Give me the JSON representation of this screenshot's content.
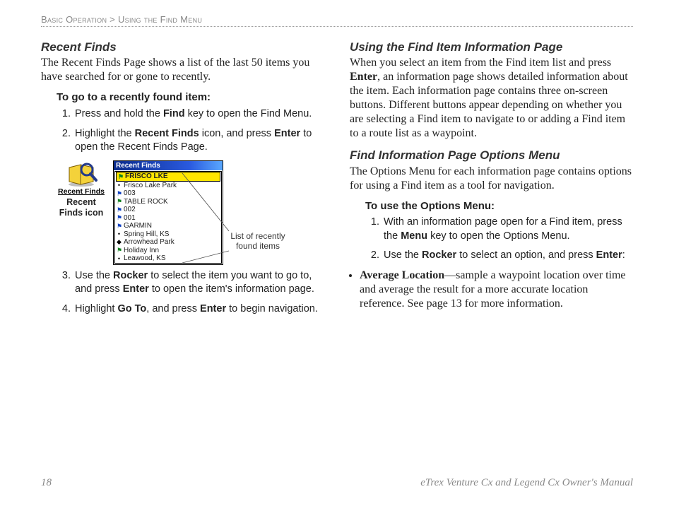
{
  "running_head": {
    "left": "Basic Operation",
    "sep": " > ",
    "right": "Using the Find Menu"
  },
  "left_col": {
    "h_recent": "Recent Finds",
    "p_recent": "The Recent Finds Page shows a list of the last 50 items you have searched for or gone to recently.",
    "instr_head": "To go to a recently found item:",
    "steps": {
      "s1a": "Press and hold the ",
      "s1b": "Find",
      "s1c": " key to open the Find Menu.",
      "s2a": "Highlight the ",
      "s2b": "Recent Finds",
      "s2c": " icon, and press ",
      "s2d": "Enter",
      "s2e": " to open the Recent Finds Page.",
      "s3a": "Use the ",
      "s3b": "Rocker",
      "s3c": " to select the item you want to go to, and press ",
      "s3d": "Enter",
      "s3e": " to open the item's information page.",
      "s4a": "Highlight ",
      "s4b": "Go To",
      "s4c": ", and press ",
      "s4d": "Enter",
      "s4e": " to begin navigation."
    },
    "icon_caption": "Recent Finds icon",
    "icon_label": "Recent Finds",
    "callout": "List of recently found items",
    "device": {
      "title": "Recent Finds",
      "items": [
        {
          "mark": "flag-green",
          "text": "FRISCO LKE",
          "sel": true
        },
        {
          "mark": "dot",
          "text": "Frisco Lake Park"
        },
        {
          "mark": "flag-blue",
          "text": "003"
        },
        {
          "mark": "flag-green",
          "text": "TABLE ROCK"
        },
        {
          "mark": "flag-blue",
          "text": "002"
        },
        {
          "mark": "flag-blue",
          "text": "001"
        },
        {
          "mark": "flag-blue",
          "text": "GARMIN"
        },
        {
          "mark": "dot",
          "text": "Spring Hill, KS"
        },
        {
          "mark": "diamond",
          "text": "Arrowhead Park"
        },
        {
          "mark": "flag-green",
          "text": "Holiday Inn"
        },
        {
          "mark": "dot",
          "text": "Leawood, KS"
        }
      ]
    }
  },
  "right_col": {
    "h_info": "Using the Find Item Information Page",
    "p_info_a": "When you select an item from the Find item list and press ",
    "p_info_b": "Enter",
    "p_info_c": ", an information page shows detailed information about the item. Each information page contains three on-screen buttons. Different buttons appear depending on whether you are selecting a Find item to navigate to or adding a Find item to a route list as a waypoint.",
    "h_opts": "Find Information Page Options Menu",
    "p_opts": "The Options Menu for each information page contains options for using a Find item as a tool for navigation.",
    "instr_head": "To use the Options Menu:",
    "steps": {
      "s1a": "With an information page open for a Find item, press the ",
      "s1b": "Menu",
      "s1c": " key to open the Options Menu.",
      "s2a": "Use the ",
      "s2b": "Rocker",
      "s2c": " to select an option, and press ",
      "s2d": "Enter",
      "s2e": ":"
    },
    "bullet": {
      "b1a": "Average Location",
      "b1b": "—sample a waypoint location over time and average the result for a more accurate location reference. See page 13 for more information."
    }
  },
  "footer": {
    "page": "18",
    "manual": "eTrex Venture Cx and Legend Cx Owner's Manual"
  }
}
